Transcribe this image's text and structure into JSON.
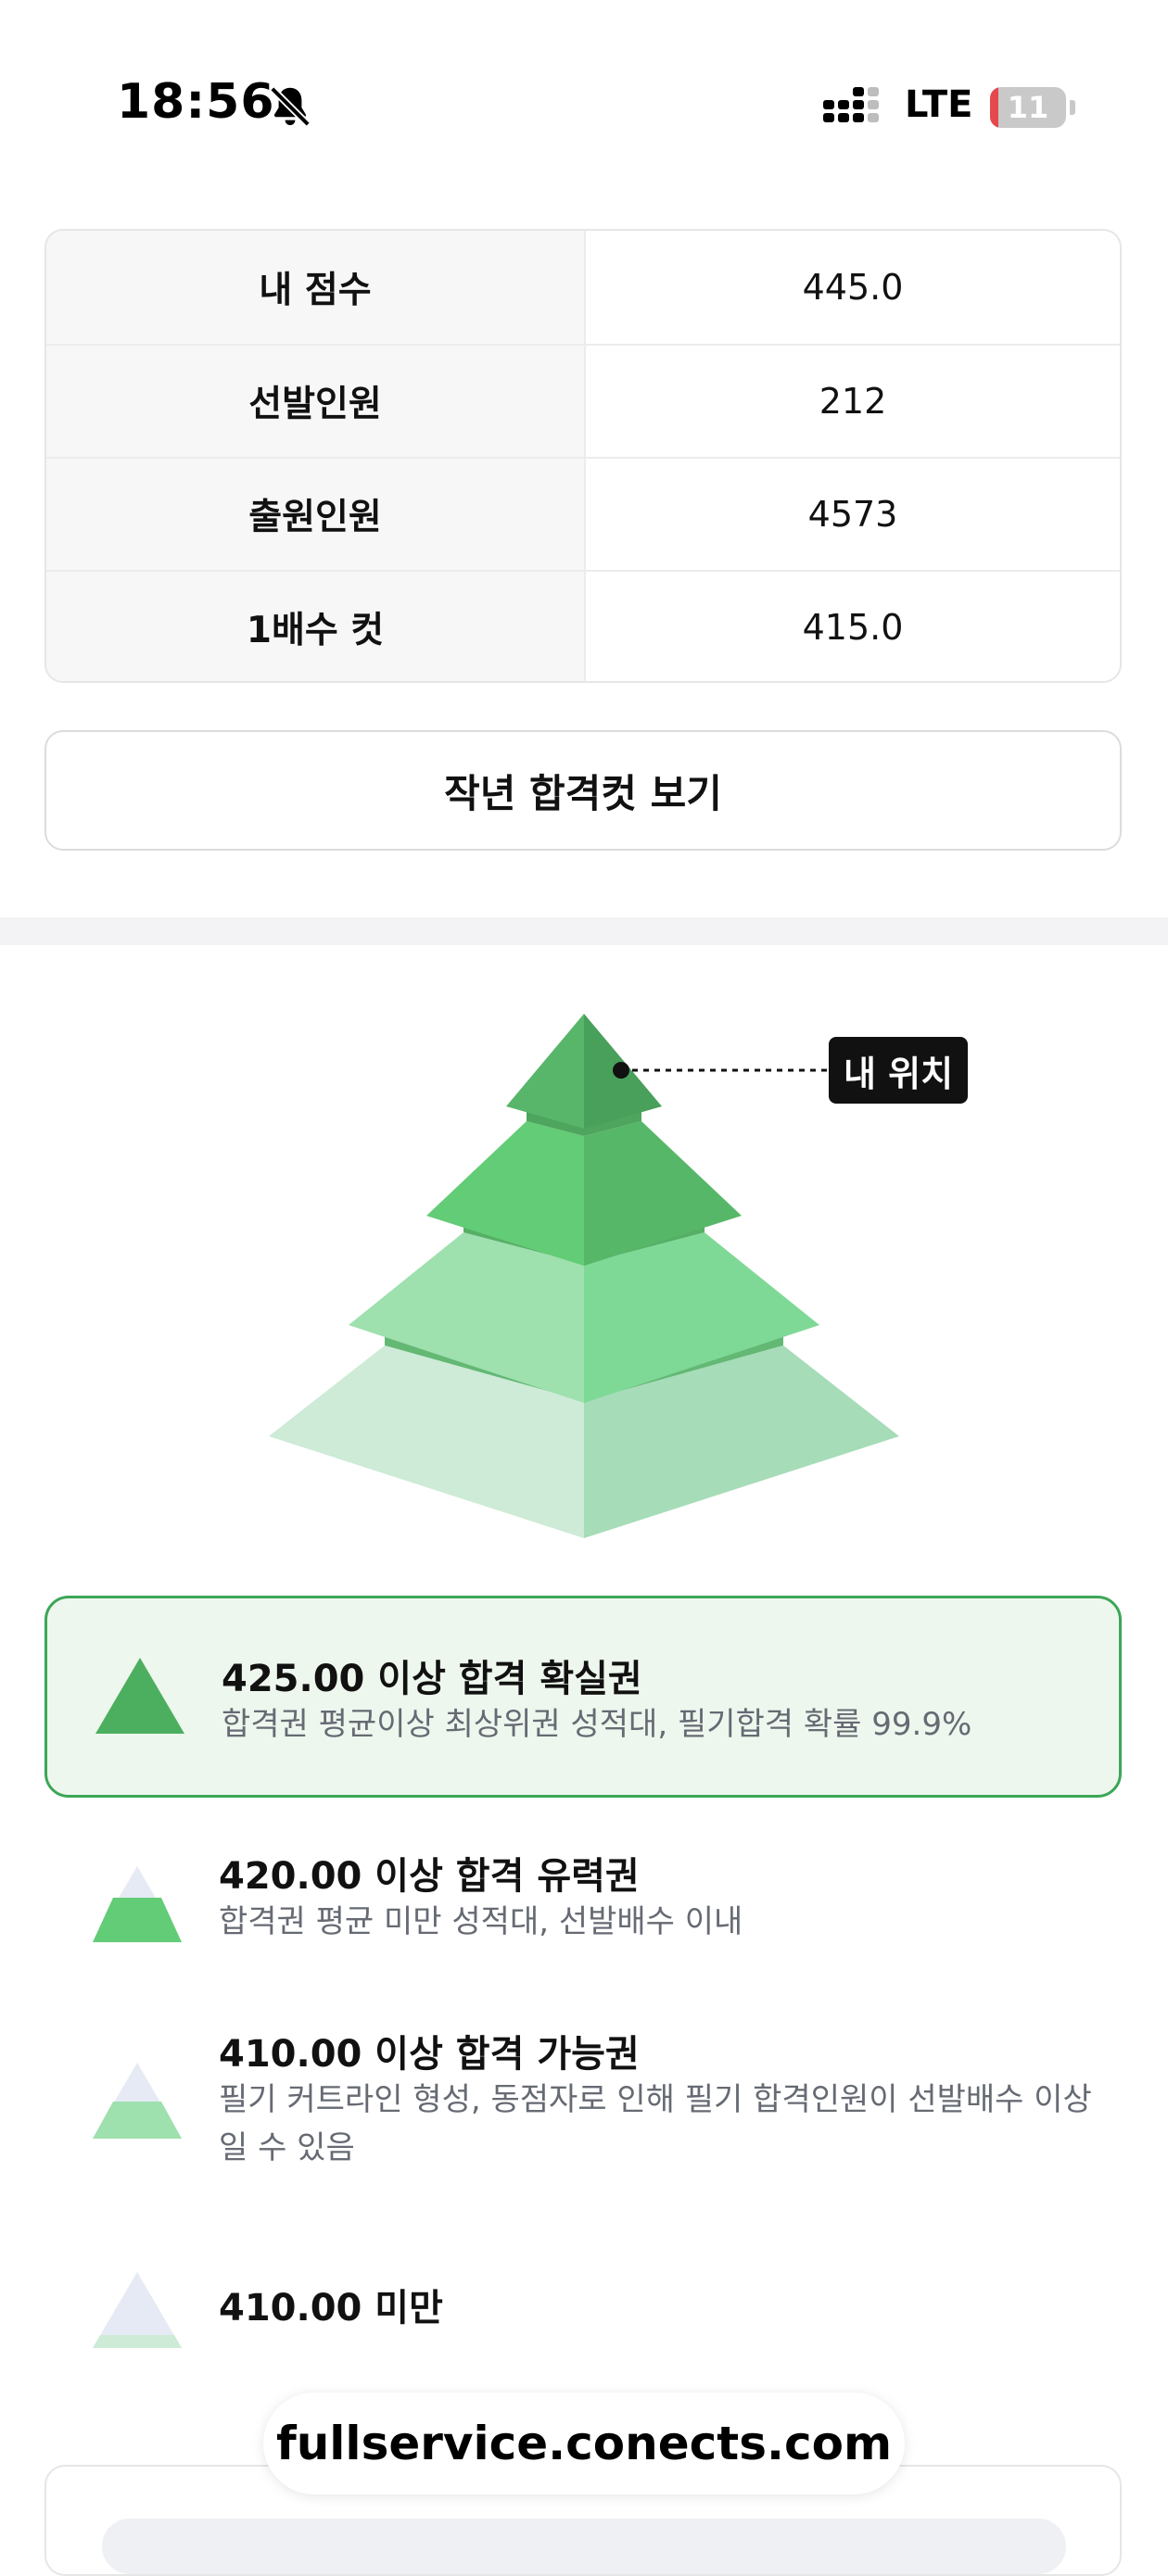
{
  "status_bar": {
    "time": "18:56",
    "network": "LTE",
    "battery_level": "11",
    "icons": [
      "bell-muted-icon",
      "signal-icon",
      "battery-icon"
    ],
    "battery_color": "#e5484d"
  },
  "info_table": {
    "rows": [
      {
        "label": "내 점수",
        "value": "445.0"
      },
      {
        "label": "선발인원",
        "value": "212"
      },
      {
        "label": "출원인원",
        "value": "4573"
      },
      {
        "label": "1배수 컷",
        "value": "415.0"
      }
    ]
  },
  "last_year_button": {
    "label": "작년 합격컷 보기"
  },
  "pyramid": {
    "my_position_label": "내 위치",
    "current_tier": 1,
    "colors": {
      "tier1": "#4caf5f",
      "tier2": "#63cc76",
      "tier3": "#9ee0ae",
      "tier4": "#cdebd6",
      "accent": "#3ca657"
    }
  },
  "legend": [
    {
      "title": "425.00 이상 합격 확실권",
      "desc": "합격권 평균이상 최상위권 성적대, 필기합격 확률 99.9%",
      "active": true
    },
    {
      "title": "420.00 이상 합격 유력권",
      "desc": "합격권 평균 미만 성적대, 선발배수 이내",
      "active": false
    },
    {
      "title": "410.00 이상 합격 가능권",
      "desc": "필기 커트라인 형성, 동점자로 인해 필기 합격인원이 선발배수 이상일 수 있음",
      "active": false
    },
    {
      "title": "410.00 미만",
      "desc": "",
      "active": false
    }
  ],
  "browser": {
    "url": "fullservice.conects.com"
  }
}
